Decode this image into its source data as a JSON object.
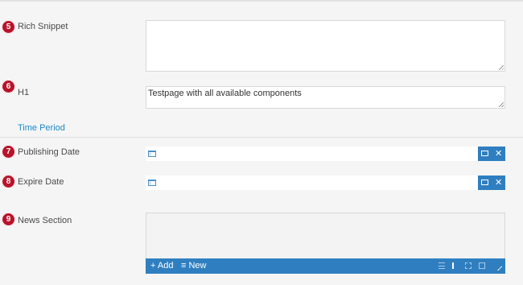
{
  "fields": {
    "rich_snippet": {
      "badge": "5",
      "label": "Rich Snippet",
      "value": ""
    },
    "h1": {
      "badge": "6",
      "label": "H1",
      "value": "Testpage with all available components"
    },
    "section": {
      "label": "Time Period"
    },
    "publishing_date": {
      "badge": "7",
      "label": "Publishing Date",
      "value": ""
    },
    "expire_date": {
      "badge": "8",
      "label": "Expire Date",
      "value": ""
    },
    "news_section": {
      "badge": "9",
      "label": "News Section"
    }
  },
  "toolbar": {
    "add_label": "+ Add",
    "new_label": "New"
  },
  "icons": {
    "badge_color": "#b8132a",
    "accent": "#2f7fc0",
    "link": "#1c8ac9",
    "calendar": "calendar-icon",
    "dialog": "dialog-icon",
    "clear": "close-icon"
  }
}
